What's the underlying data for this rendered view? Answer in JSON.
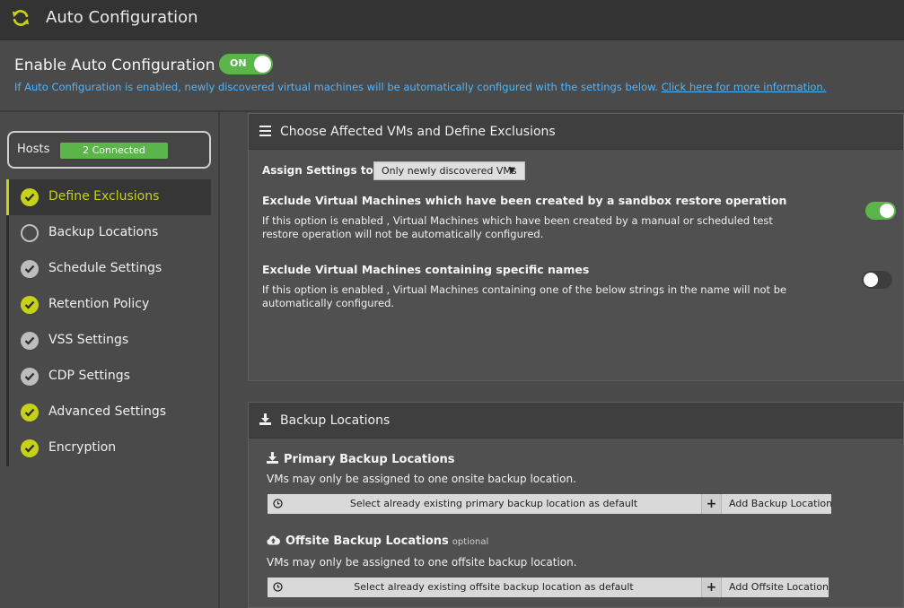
{
  "window": {
    "title": "Auto Configuration",
    "icon": "refresh-icon"
  },
  "enable": {
    "label": "Enable Auto Configuration",
    "toggle_text": "ON",
    "toggle_state": true,
    "info_text": "If Auto Configuration is enabled, newly discovered virtual machines will be automatically configured with the settings below.",
    "info_link": "Click here for more information."
  },
  "sidebar": {
    "hosts_label": "Hosts",
    "hosts_badge": "2 Connected",
    "steps": [
      {
        "label": "Define Exclusions",
        "state": "done-green",
        "active": true
      },
      {
        "label": "Backup Locations",
        "state": "empty",
        "active": false
      },
      {
        "label": "Schedule Settings",
        "state": "done-gray",
        "active": false
      },
      {
        "label": "Retention Policy",
        "state": "done-green",
        "active": false
      },
      {
        "label": "VSS Settings",
        "state": "done-gray",
        "active": false
      },
      {
        "label": "CDP Settings",
        "state": "done-gray",
        "active": false
      },
      {
        "label": "Advanced Settings",
        "state": "done-green",
        "active": false
      },
      {
        "label": "Encryption",
        "state": "done-green",
        "active": false
      }
    ]
  },
  "exclusions": {
    "header": "Choose Affected VMs and Define Exclusions",
    "header_icon": "menu-icon",
    "assign_label": "Assign Settings to:",
    "assign_value": "Only newly discovered VMs",
    "option1": {
      "title": "Exclude Virtual Machines which have been created by a sandbox restore operation",
      "desc": "If this option is enabled , Virtual Machines which have been created by a manual or scheduled test restore operation will not be automatically configured.",
      "enabled": true
    },
    "option2": {
      "title": "Exclude Virtual Machines containing specific names",
      "desc": "If this option is enabled , Virtual Machines containing one of the below strings in the name will not be automatically configured.",
      "enabled": false
    }
  },
  "backup": {
    "header": "Backup Locations",
    "header_icon": "download-icon",
    "primary": {
      "title": "Primary Backup Locations",
      "desc": "VMs may only be assigned to one onsite backup location.",
      "select_text": "Select already existing primary backup location as default",
      "add_label": "Add Backup Location"
    },
    "offsite": {
      "title": "Offsite Backup Locations",
      "optional": "optional",
      "desc": "VMs may only be assigned to one offsite backup location.",
      "select_text": "Select already existing offsite backup location as default",
      "add_label": "Add Offsite Location"
    }
  },
  "colors": {
    "accent": "#c6d21a",
    "toggle_on": "#5bb54b",
    "link": "#4fb5ff"
  }
}
